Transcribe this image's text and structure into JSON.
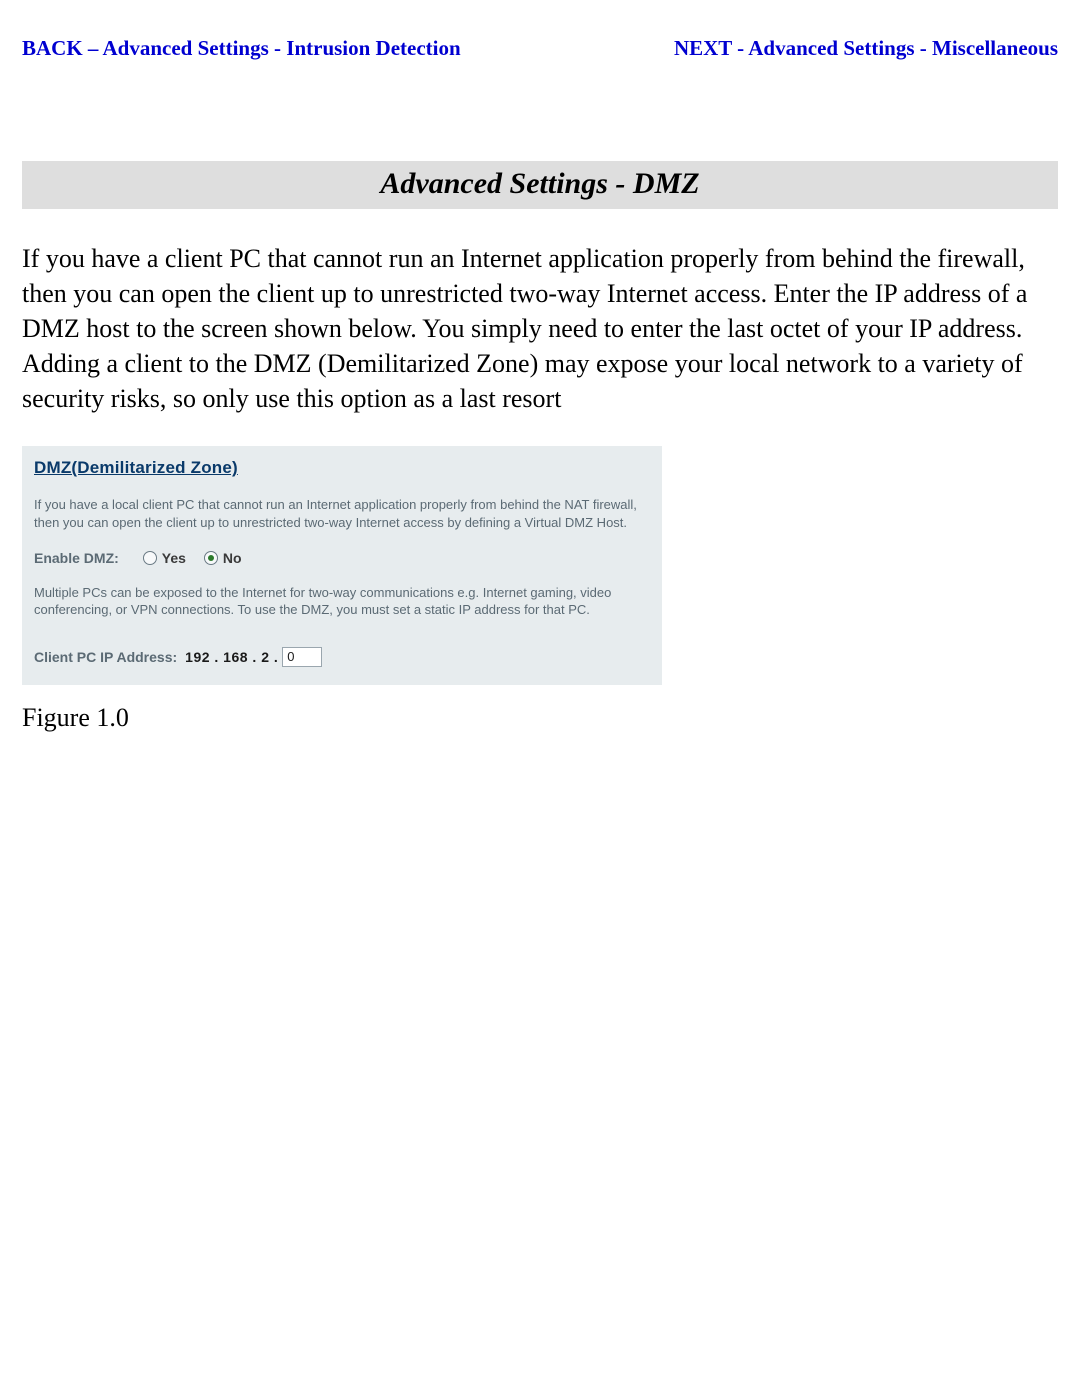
{
  "nav": {
    "back_label": "BACK – Advanced Settings - Intrusion Detection",
    "next_label": "NEXT - Advanced Settings - Miscellaneous"
  },
  "title": "Advanced Settings - DMZ",
  "body_paragraph": "If you have a client PC that cannot run an Internet application properly from behind the firewall, then you can open the client up to unrestricted two-way Internet access. Enter the IP address of a DMZ host to the screen shown below. You simply need to enter the last octet of your IP address. Adding a client to the DMZ (Demilitarized Zone) may expose your local network to a variety of security risks, so only use this option as a last resort",
  "panel": {
    "heading": "DMZ(Demilitarized Zone)",
    "description": "If you have a local client PC that cannot run an Internet application properly from behind the NAT firewall, then you can open the client up to unrestricted two-way Internet access by defining a Virtual DMZ Host.",
    "enable_label": "Enable DMZ:",
    "options": {
      "yes": "Yes",
      "no": "No"
    },
    "selected": "No",
    "note": "Multiple PCs can be exposed to the Internet for two-way communications e.g. Internet gaming, video conferencing, or VPN connections.  To use the DMZ, you must set a static IP address for that PC.",
    "ip_label": "Client PC IP Address:",
    "ip_prefix": "192 . 168 . 2 .",
    "ip_last_octet": "0"
  },
  "figure_caption": "Figure 1.0"
}
